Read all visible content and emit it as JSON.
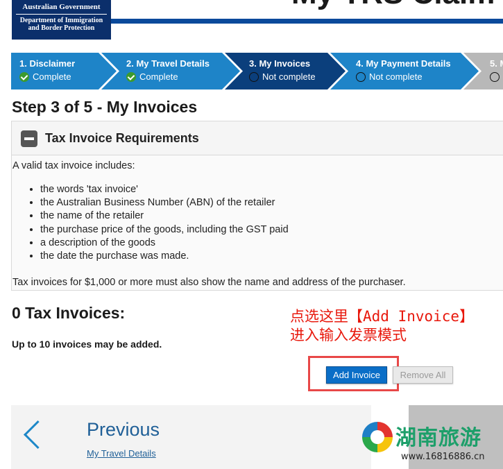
{
  "header": {
    "gov_line1": "Australian Government",
    "gov_line2": "Department of Immigration",
    "gov_line3": "and Border Protection",
    "page_title": "My TRS Claim"
  },
  "stepper": {
    "steps": [
      {
        "title": "1. Disclaimer",
        "status": "Complete",
        "state": "complete"
      },
      {
        "title": "2. My Travel Details",
        "status": "Complete",
        "state": "complete"
      },
      {
        "title": "3. My Invoices",
        "status": "Not complete",
        "state": "current"
      },
      {
        "title": "4. My Payment Details",
        "status": "Not complete",
        "state": "incomplete"
      },
      {
        "title": "5. M",
        "status": "",
        "state": "future"
      }
    ],
    "colors": {
      "complete": "#1e84c8",
      "current": "#0b3f7c",
      "incomplete": "#1e84c8",
      "future": "#b8b8b8"
    }
  },
  "main": {
    "heading": "Step 3 of 5 - My Invoices",
    "panel": {
      "title": "Tax Invoice Requirements",
      "intro": "A valid tax invoice includes:",
      "items": [
        "the words 'tax invoice'",
        "the Australian Business Number (ABN) of the retailer",
        "the name of the retailer",
        "the purchase price of the goods, including the GST paid",
        "a description of the goods",
        "the date the purchase was made."
      ],
      "footer": "Tax invoices for $1,000 or more must also show the name and address of the purchaser."
    },
    "invoices": {
      "count_label": "0 Tax Invoices:",
      "limit_text": "Up to 10 invoices may be added.",
      "add_label": "Add Invoice",
      "remove_label": "Remove All"
    }
  },
  "annotation": {
    "line1_a": "点选这里【",
    "line1_b": "Add Invoice",
    "line1_c": "】",
    "line2": "进入输入发票模式",
    "color": "#e8180c"
  },
  "nav": {
    "previous_label": "Previous",
    "previous_link": "My Travel Details"
  },
  "watermark": {
    "text": "湖南旅游",
    "url": "www.16816886.cn"
  }
}
